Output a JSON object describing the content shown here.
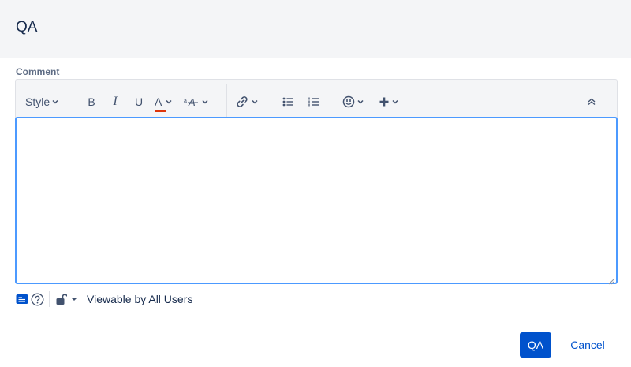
{
  "dialog": {
    "title": "QA"
  },
  "comment": {
    "label": "Comment",
    "value": ""
  },
  "toolbar": {
    "style_label": "Style",
    "bold": "B",
    "italic": "I",
    "underline": "U",
    "text_color": "A",
    "icons": [
      "chevron-down-icon",
      "link-icon",
      "bullet-list-icon",
      "numbered-list-icon",
      "emoji-icon",
      "plus-icon",
      "collapse-icon"
    ],
    "text_color_underline": "#de350b"
  },
  "footer": {
    "visibility_text": "Viewable by All Users"
  },
  "actions": {
    "submit_label": "QA",
    "cancel_label": "Cancel"
  },
  "colors": {
    "primary": "#0052cc",
    "focus": "#4c9aff",
    "header_bg": "#f4f5f7"
  }
}
